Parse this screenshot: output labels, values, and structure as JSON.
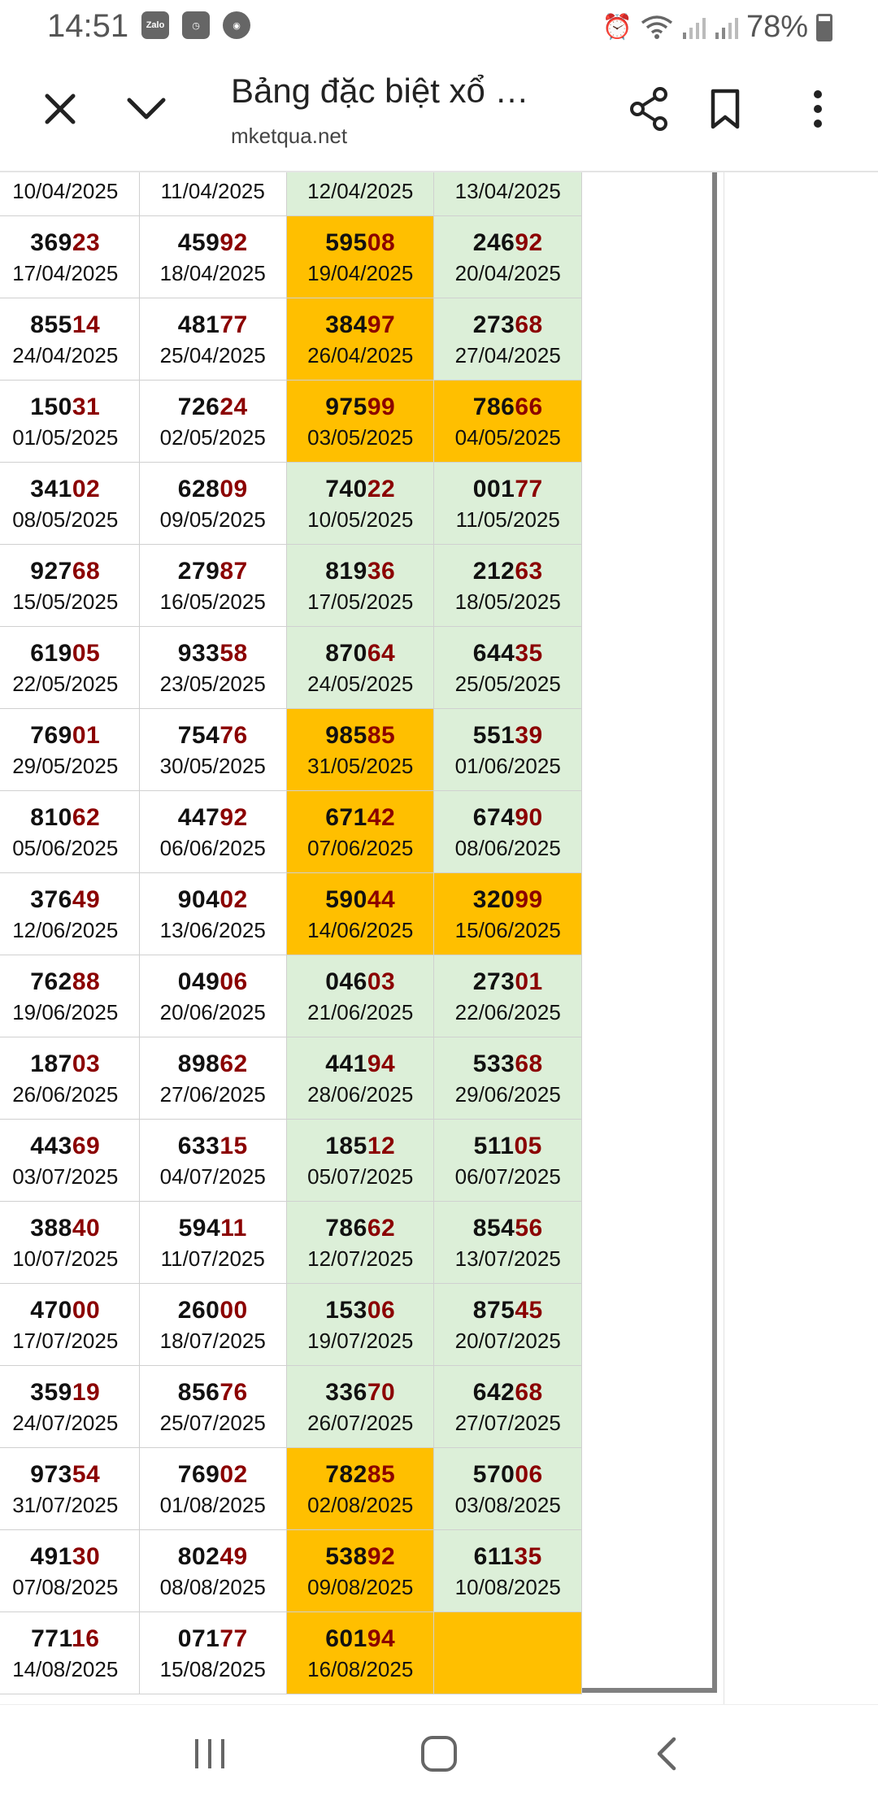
{
  "status": {
    "time": "14:51",
    "notifications": [
      "Zalo",
      "clock-app-icon",
      "browser-app-icon"
    ],
    "battery": "78%"
  },
  "browser": {
    "title": "Bảng đặc biệt xổ …",
    "url": "mketqua.net"
  },
  "colors": {
    "header_gray": "#808080",
    "weekend_green": "#dcefd8",
    "highlight_gold": "#ffbf00",
    "tail_red": "#8b0000"
  },
  "table": {
    "rows": [
      {
        "edge": "25",
        "cells": [
          {
            "head": "",
            "tail": "",
            "date": "10/04/2025",
            "bg": "plain"
          },
          {
            "head": "",
            "tail": "",
            "date": "11/04/2025",
            "bg": "plain"
          },
          {
            "head": "",
            "tail": "",
            "date": "12/04/2025",
            "bg": "green"
          },
          {
            "head": "",
            "tail": "",
            "date": "13/04/2025",
            "bg": "green"
          }
        ]
      },
      {
        "edge": "25",
        "cells": [
          {
            "head": "369",
            "tail": "23",
            "date": "17/04/2025",
            "bg": "plain"
          },
          {
            "head": "459",
            "tail": "92",
            "date": "18/04/2025",
            "bg": "plain"
          },
          {
            "head": "595",
            "tail": "08",
            "date": "19/04/2025",
            "bg": "gold"
          },
          {
            "head": "246",
            "tail": "92",
            "date": "20/04/2025",
            "bg": "green"
          }
        ]
      },
      {
        "edge": "25",
        "cells": [
          {
            "head": "855",
            "tail": "14",
            "date": "24/04/2025",
            "bg": "plain"
          },
          {
            "head": "481",
            "tail": "77",
            "date": "25/04/2025",
            "bg": "plain"
          },
          {
            "head": "384",
            "tail": "97",
            "date": "26/04/2025",
            "bg": "gold"
          },
          {
            "head": "273",
            "tail": "68",
            "date": "27/04/2025",
            "bg": "green"
          }
        ]
      },
      {
        "edge": "25",
        "cells": [
          {
            "head": "150",
            "tail": "31",
            "date": "01/05/2025",
            "bg": "plain"
          },
          {
            "head": "726",
            "tail": "24",
            "date": "02/05/2025",
            "bg": "plain"
          },
          {
            "head": "975",
            "tail": "99",
            "date": "03/05/2025",
            "bg": "gold"
          },
          {
            "head": "786",
            "tail": "66",
            "date": "04/05/2025",
            "bg": "gold"
          }
        ]
      },
      {
        "edge": "25",
        "cells": [
          {
            "head": "341",
            "tail": "02",
            "date": "08/05/2025",
            "bg": "plain"
          },
          {
            "head": "628",
            "tail": "09",
            "date": "09/05/2025",
            "bg": "plain"
          },
          {
            "head": "740",
            "tail": "22",
            "date": "10/05/2025",
            "bg": "green"
          },
          {
            "head": "001",
            "tail": "77",
            "date": "11/05/2025",
            "bg": "green"
          }
        ]
      },
      {
        "edge": "25",
        "cells": [
          {
            "head": "927",
            "tail": "68",
            "date": "15/05/2025",
            "bg": "plain"
          },
          {
            "head": "279",
            "tail": "87",
            "date": "16/05/2025",
            "bg": "plain"
          },
          {
            "head": "819",
            "tail": "36",
            "date": "17/05/2025",
            "bg": "green"
          },
          {
            "head": "212",
            "tail": "63",
            "date": "18/05/2025",
            "bg": "green"
          }
        ]
      },
      {
        "edge": "25",
        "cells": [
          {
            "head": "619",
            "tail": "05",
            "date": "22/05/2025",
            "bg": "plain"
          },
          {
            "head": "933",
            "tail": "58",
            "date": "23/05/2025",
            "bg": "plain"
          },
          {
            "head": "870",
            "tail": "64",
            "date": "24/05/2025",
            "bg": "green"
          },
          {
            "head": "644",
            "tail": "35",
            "date": "25/05/2025",
            "bg": "green"
          }
        ]
      },
      {
        "edge": "25",
        "cells": [
          {
            "head": "769",
            "tail": "01",
            "date": "29/05/2025",
            "bg": "plain"
          },
          {
            "head": "754",
            "tail": "76",
            "date": "30/05/2025",
            "bg": "plain"
          },
          {
            "head": "985",
            "tail": "85",
            "date": "31/05/2025",
            "bg": "gold"
          },
          {
            "head": "551",
            "tail": "39",
            "date": "01/06/2025",
            "bg": "green"
          }
        ]
      },
      {
        "edge": "25",
        "cells": [
          {
            "head": "810",
            "tail": "62",
            "date": "05/06/2025",
            "bg": "plain"
          },
          {
            "head": "447",
            "tail": "92",
            "date": "06/06/2025",
            "bg": "plain"
          },
          {
            "head": "671",
            "tail": "42",
            "date": "07/06/2025",
            "bg": "gold"
          },
          {
            "head": "674",
            "tail": "90",
            "date": "08/06/2025",
            "bg": "green"
          }
        ]
      },
      {
        "edge": "25",
        "cells": [
          {
            "head": "376",
            "tail": "49",
            "date": "12/06/2025",
            "bg": "plain"
          },
          {
            "head": "904",
            "tail": "02",
            "date": "13/06/2025",
            "bg": "plain"
          },
          {
            "head": "590",
            "tail": "44",
            "date": "14/06/2025",
            "bg": "gold"
          },
          {
            "head": "320",
            "tail": "99",
            "date": "15/06/2025",
            "bg": "gold"
          }
        ]
      },
      {
        "edge": "25",
        "cells": [
          {
            "head": "762",
            "tail": "88",
            "date": "19/06/2025",
            "bg": "plain"
          },
          {
            "head": "049",
            "tail": "06",
            "date": "20/06/2025",
            "bg": "plain"
          },
          {
            "head": "046",
            "tail": "03",
            "date": "21/06/2025",
            "bg": "green"
          },
          {
            "head": "273",
            "tail": "01",
            "date": "22/06/2025",
            "bg": "green"
          }
        ]
      },
      {
        "edge": "25",
        "cells": [
          {
            "head": "187",
            "tail": "03",
            "date": "26/06/2025",
            "bg": "plain"
          },
          {
            "head": "898",
            "tail": "62",
            "date": "27/06/2025",
            "bg": "plain"
          },
          {
            "head": "441",
            "tail": "94",
            "date": "28/06/2025",
            "bg": "green"
          },
          {
            "head": "533",
            "tail": "68",
            "date": "29/06/2025",
            "bg": "green"
          }
        ]
      },
      {
        "edge": "25",
        "cells": [
          {
            "head": "443",
            "tail": "69",
            "date": "03/07/2025",
            "bg": "plain"
          },
          {
            "head": "633",
            "tail": "15",
            "date": "04/07/2025",
            "bg": "plain"
          },
          {
            "head": "185",
            "tail": "12",
            "date": "05/07/2025",
            "bg": "green"
          },
          {
            "head": "511",
            "tail": "05",
            "date": "06/07/2025",
            "bg": "green"
          }
        ]
      },
      {
        "edge": "25",
        "cells": [
          {
            "head": "388",
            "tail": "40",
            "date": "10/07/2025",
            "bg": "plain"
          },
          {
            "head": "594",
            "tail": "11",
            "date": "11/07/2025",
            "bg": "plain"
          },
          {
            "head": "786",
            "tail": "62",
            "date": "12/07/2025",
            "bg": "green"
          },
          {
            "head": "854",
            "tail": "56",
            "date": "13/07/2025",
            "bg": "green"
          }
        ]
      },
      {
        "edge": "25",
        "cells": [
          {
            "head": "470",
            "tail": "00",
            "date": "17/07/2025",
            "bg": "plain"
          },
          {
            "head": "260",
            "tail": "00",
            "date": "18/07/2025",
            "bg": "plain"
          },
          {
            "head": "153",
            "tail": "06",
            "date": "19/07/2025",
            "bg": "green"
          },
          {
            "head": "875",
            "tail": "45",
            "date": "20/07/2025",
            "bg": "green"
          }
        ]
      },
      {
        "edge": "25",
        "cells": [
          {
            "head": "359",
            "tail": "19",
            "date": "24/07/2025",
            "bg": "plain"
          },
          {
            "head": "856",
            "tail": "76",
            "date": "25/07/2025",
            "bg": "plain"
          },
          {
            "head": "336",
            "tail": "70",
            "date": "26/07/2025",
            "bg": "green"
          },
          {
            "head": "642",
            "tail": "68",
            "date": "27/07/2025",
            "bg": "green"
          }
        ]
      },
      {
        "edge": "25",
        "cells": [
          {
            "head": "973",
            "tail": "54",
            "date": "31/07/2025",
            "bg": "plain"
          },
          {
            "head": "769",
            "tail": "02",
            "date": "01/08/2025",
            "bg": "plain"
          },
          {
            "head": "782",
            "tail": "85",
            "date": "02/08/2025",
            "bg": "gold"
          },
          {
            "head": "570",
            "tail": "06",
            "date": "03/08/2025",
            "bg": "green"
          }
        ]
      },
      {
        "edge": "25",
        "cells": [
          {
            "head": "491",
            "tail": "30",
            "date": "07/08/2025",
            "bg": "plain"
          },
          {
            "head": "802",
            "tail": "49",
            "date": "08/08/2025",
            "bg": "plain"
          },
          {
            "head": "538",
            "tail": "92",
            "date": "09/08/2025",
            "bg": "gold"
          },
          {
            "head": "611",
            "tail": "35",
            "date": "10/08/2025",
            "bg": "green"
          }
        ]
      },
      {
        "edge": "25",
        "cells": [
          {
            "head": "771",
            "tail": "16",
            "date": "14/08/2025",
            "bg": "plain"
          },
          {
            "head": "071",
            "tail": "77",
            "date": "15/08/2025",
            "bg": "plain"
          },
          {
            "head": "601",
            "tail": "94",
            "date": "16/08/2025",
            "bg": "gold"
          },
          {
            "head": "",
            "tail": "",
            "date": "",
            "bg": "gold"
          }
        ]
      }
    ]
  }
}
